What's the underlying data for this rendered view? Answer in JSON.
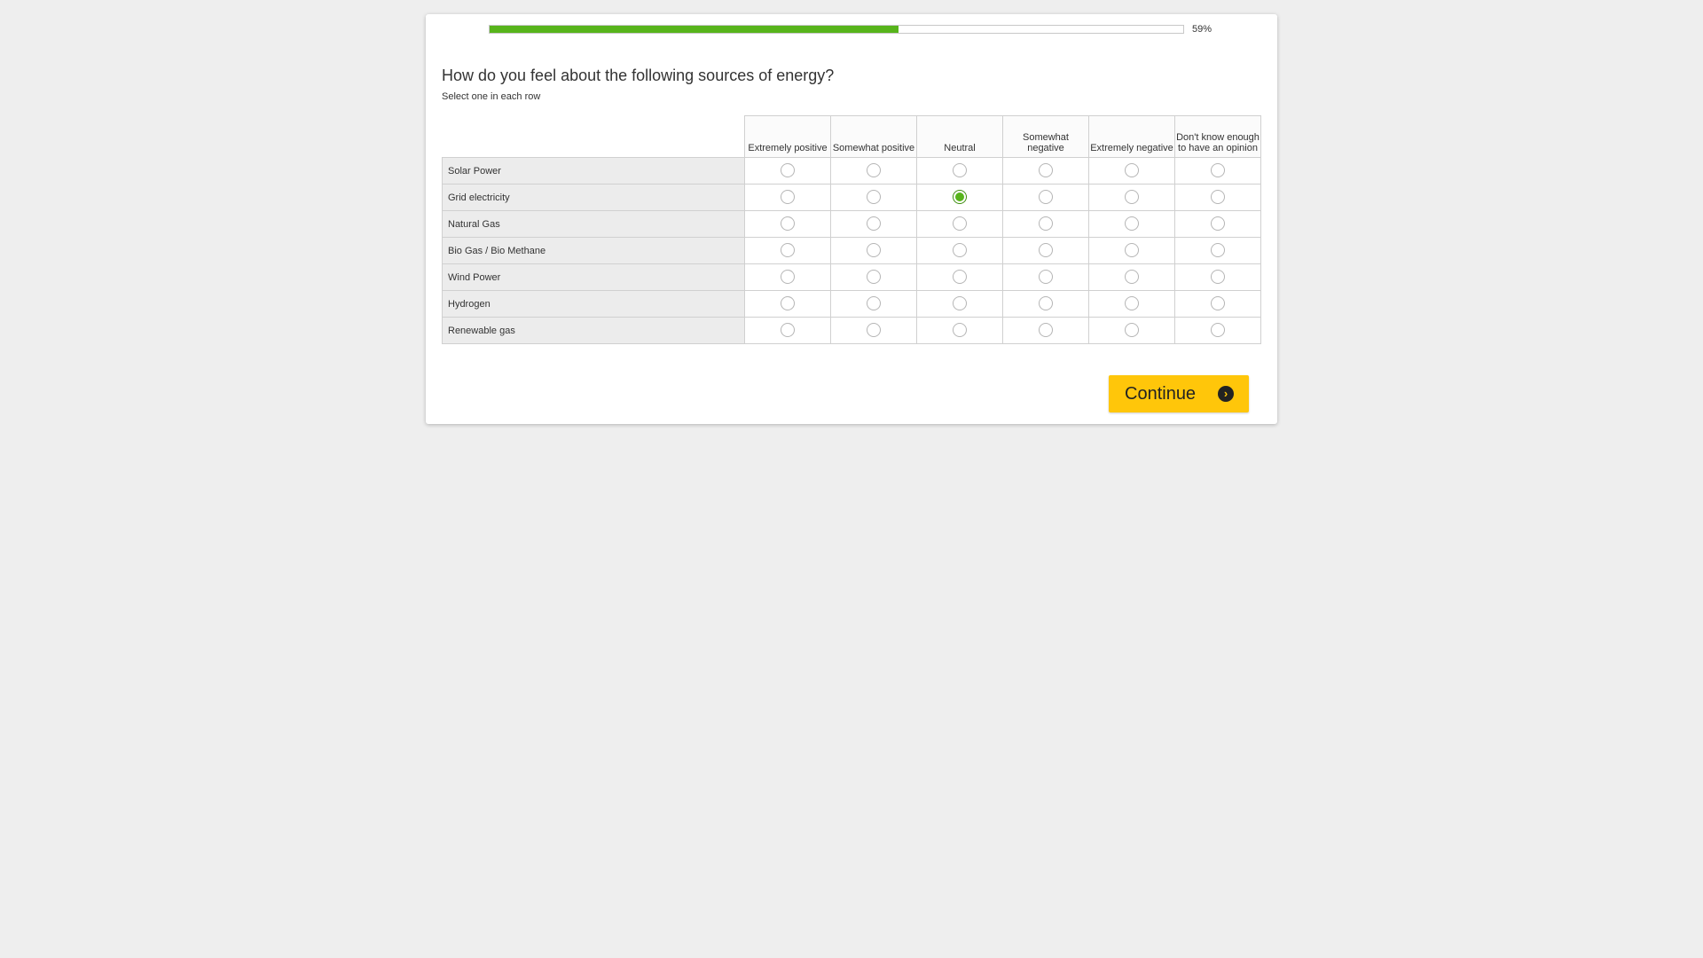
{
  "progress": {
    "value": 0.59,
    "label": "59%",
    "fill_color": "#57b41b"
  },
  "question": {
    "title": "How do you feel about the following sources of energy?",
    "instruction": "Select one in each row"
  },
  "grid": {
    "columns": [
      "Extremely positive",
      "Somewhat positive",
      "Neutral",
      "Somewhat negative",
      "Extremely negative",
      "Don't know enough to have an opinion"
    ],
    "rows": [
      {
        "label": "Solar Power",
        "selected": null
      },
      {
        "label": "Grid electricity",
        "selected": 2
      },
      {
        "label": "Natural Gas",
        "selected": null
      },
      {
        "label": "Bio Gas / Bio Methane",
        "selected": null
      },
      {
        "label": "Wind Power",
        "selected": null
      },
      {
        "label": "Hydrogen",
        "selected": null
      },
      {
        "label": "Renewable gas",
        "selected": null
      }
    ]
  },
  "continue_button": {
    "label": "Continue",
    "icon": "chevron-right-circle-icon",
    "color": "#ffc60a"
  }
}
